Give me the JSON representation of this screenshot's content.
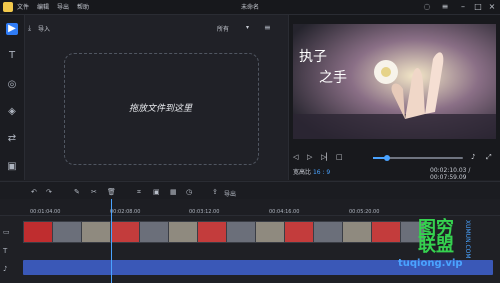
{
  "app": {
    "title": "未命名"
  },
  "menu": [
    "文件",
    "编辑",
    "导出",
    "帮助"
  ],
  "window": {
    "controls": [
      "min",
      "max",
      "close"
    ]
  },
  "left_tools": [
    {
      "name": "media"
    },
    {
      "name": "text"
    },
    {
      "name": "filters"
    },
    {
      "name": "overlays"
    },
    {
      "name": "transitions"
    },
    {
      "name": "elements"
    }
  ],
  "media": {
    "import_label": "导入",
    "filter_value": "所有",
    "drop_text": "拖放文件到这里"
  },
  "preview": {
    "overlay_text_1": "执子",
    "overlay_text_2": "之手",
    "ratio_label": "宽高比",
    "ratio_value": "16 : 9",
    "timecode": "00:02:10.03 / 00:07:59.09",
    "progress_fraction": 0.15
  },
  "timeline_toolbar": {
    "export_label": "导出"
  },
  "ruler": {
    "labels": [
      "00:01:04.00",
      "00:02:08.00",
      "00:03:12.00",
      "00:04:16.00",
      "00:05:20.00"
    ]
  },
  "watermark": {
    "line1": "图穷",
    "line2": "联盟",
    "url": "tuqiong.vip",
    "side": "XUMUN.COM"
  }
}
